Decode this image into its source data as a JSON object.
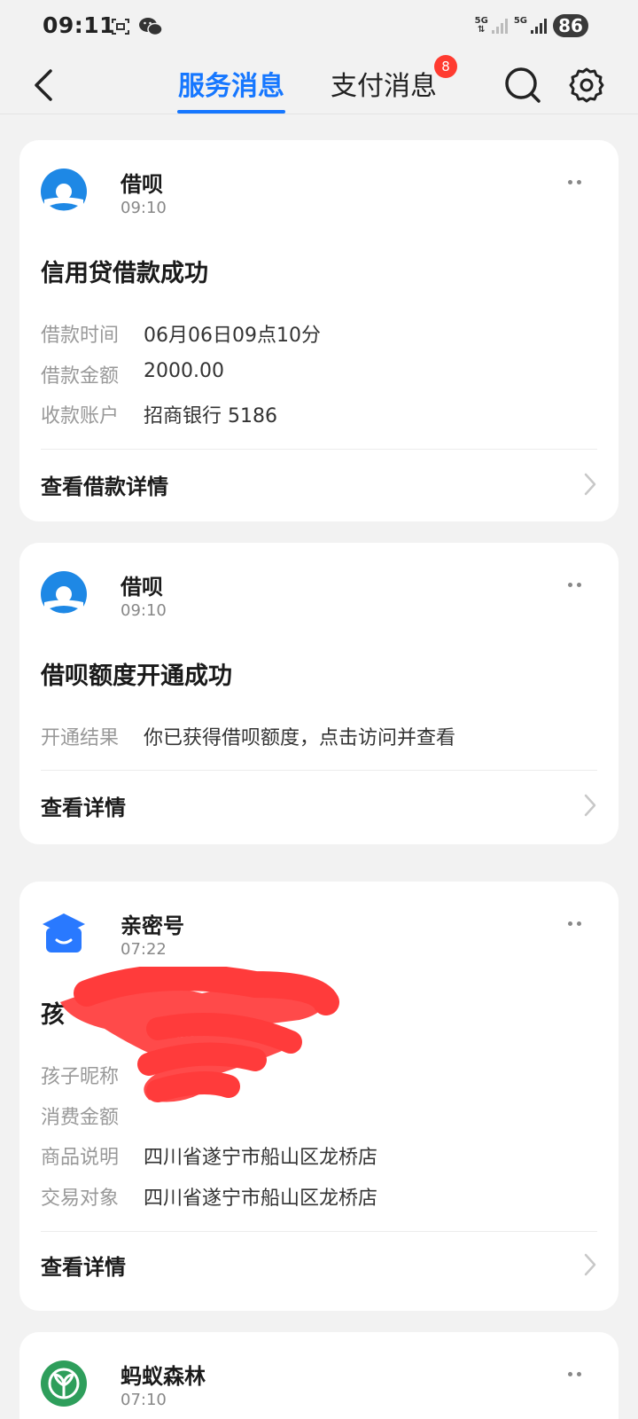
{
  "status_bar": {
    "time": "09:11",
    "net1": "5G",
    "net2": "5G",
    "battery": "86"
  },
  "header": {
    "tabs": [
      {
        "label": "服务消息",
        "active": true
      },
      {
        "label": "支付消息",
        "active": false,
        "badge": "8"
      }
    ]
  },
  "colors": {
    "accent": "#1677ff",
    "badge": "#ff3b30",
    "jiebei_blue": "#1e88e5",
    "qinmi_blue": "#2979ff",
    "forest_green": "#2e9e5b"
  },
  "cards": [
    {
      "app_name": "借呗",
      "time": "09:10",
      "icon": "jiebei-icon",
      "title": "信用贷借款成功",
      "rows": [
        {
          "key": "借款时间",
          "value": "06月06日09点10分"
        },
        {
          "key": "借款金额",
          "value": "2000.00"
        },
        {
          "key": "收款账户",
          "value": "招商银行 5186"
        }
      ],
      "link": "查看借款详情"
    },
    {
      "app_name": "借呗",
      "time": "09:10",
      "icon": "jiebei-icon",
      "title": "借呗额度开通成功",
      "rows": [
        {
          "key": "开通结果",
          "value": "你已获得借呗额度，点击访问并查看"
        }
      ],
      "link": "查看详情"
    },
    {
      "app_name": "亲密号",
      "time": "07:22",
      "icon": "graduation-cap-icon",
      "title": "孩",
      "rows": [
        {
          "key": "孩子昵称",
          "value": ""
        },
        {
          "key": "消费金额",
          "value": ""
        },
        {
          "key": "商品说明",
          "value": "四川省遂宁市船山区龙桥店"
        },
        {
          "key": "交易对象",
          "value": "四川省遂宁市船山区龙桥店"
        }
      ],
      "link": "查看详情"
    },
    {
      "app_name": "蚂蚁森林",
      "time": "07:10",
      "icon": "ant-forest-icon"
    }
  ]
}
